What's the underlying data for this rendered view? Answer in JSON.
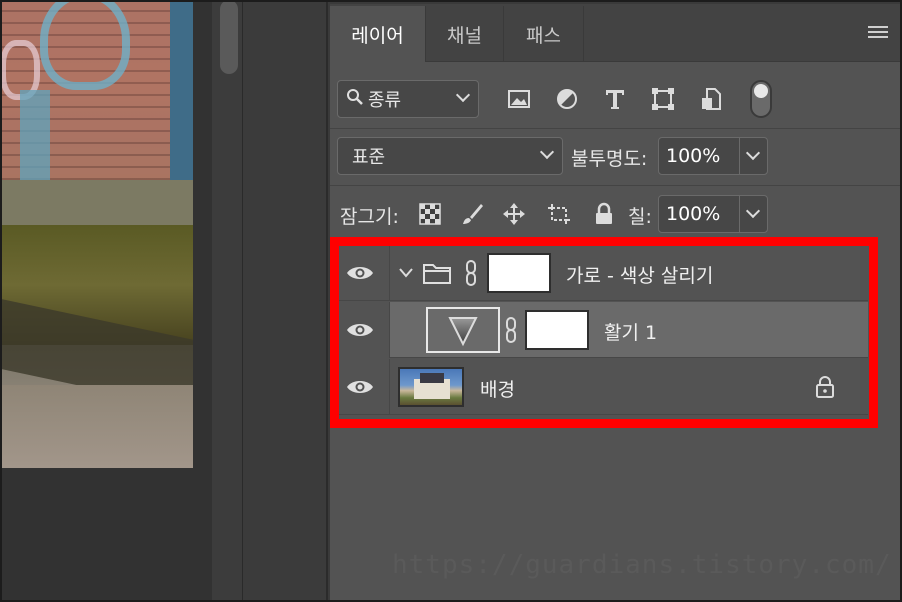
{
  "tabs": [
    {
      "label": "레이어",
      "active": true
    },
    {
      "label": "채널",
      "active": false
    },
    {
      "label": "패스",
      "active": false
    }
  ],
  "filter": {
    "kind_label": "종류",
    "icons": [
      "image-filter-icon",
      "adjustment-filter-icon",
      "type-filter-icon",
      "shape-filter-icon",
      "smart-object-filter-icon"
    ]
  },
  "blend": {
    "mode": "표준",
    "opacity_label": "불투명도:",
    "opacity_value": "100%"
  },
  "lock": {
    "label": "잠그기:",
    "fill_label": "칠:",
    "fill_value": "100%"
  },
  "layers": [
    {
      "name": "가로 - 색상 살리기",
      "type": "group",
      "visible": true,
      "expanded": true
    },
    {
      "name": "활기 1",
      "type": "adjustment",
      "visible": true,
      "selected": true
    },
    {
      "name": "배경",
      "type": "background",
      "visible": true,
      "locked": true
    }
  ],
  "watermark": "https://guardians.tistory.com/",
  "colors": {
    "highlight_box": "#ff0000",
    "panel_bg": "#535353",
    "selected_row": "#6a6a6a"
  }
}
